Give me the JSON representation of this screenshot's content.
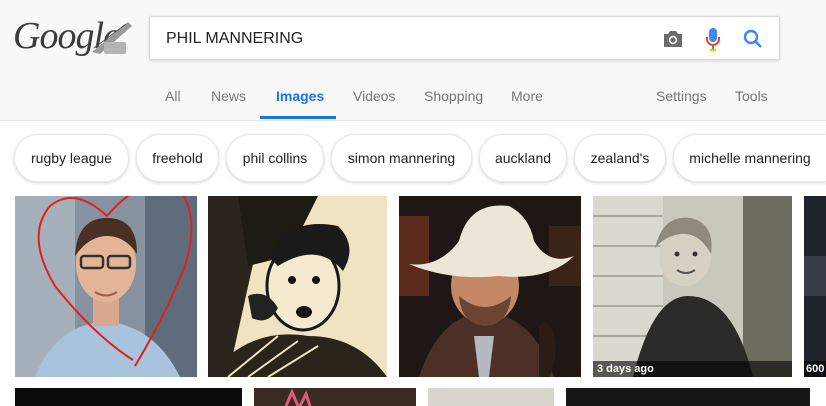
{
  "logo": {
    "text": "Google"
  },
  "search": {
    "query": "PHIL MANNERING"
  },
  "icons": {
    "camera": "camera-icon",
    "mic": "microphone-icon",
    "search": "search-icon"
  },
  "tabs": [
    {
      "label": "All"
    },
    {
      "label": "News"
    },
    {
      "label": "Images"
    },
    {
      "label": "Videos"
    },
    {
      "label": "Shopping"
    },
    {
      "label": "More"
    },
    {
      "label": "Settings"
    },
    {
      "label": "Tools"
    }
  ],
  "chips": [
    {
      "label": "rugby league"
    },
    {
      "label": "freehold"
    },
    {
      "label": "phil collins"
    },
    {
      "label": "simon mannering"
    },
    {
      "label": "auckland"
    },
    {
      "label": "zealand's"
    },
    {
      "label": "michelle mannering"
    }
  ],
  "results": [
    {
      "caption": ""
    },
    {
      "caption": ""
    },
    {
      "caption": ""
    },
    {
      "caption": "3 days ago"
    },
    {
      "caption": "600"
    }
  ],
  "colors": {
    "accent": "#1a73e8",
    "mic_blue": "#4285f4",
    "mic_red": "#ea4335",
    "heart_red": "#e0201b"
  }
}
